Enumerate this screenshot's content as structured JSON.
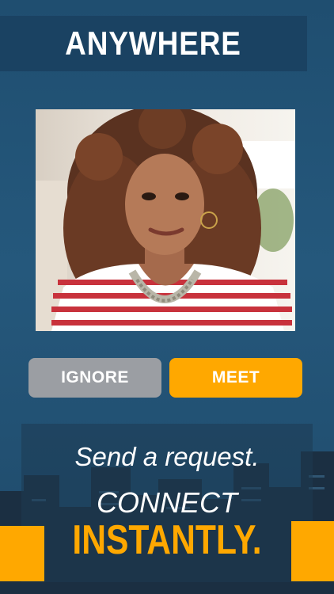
{
  "header": {
    "title": "ANYWHERE"
  },
  "profile": {
    "photo_alt": "Portrait of a smiling woman with curly hair in a striped shirt"
  },
  "actions": {
    "ignore_label": "IGNORE",
    "meet_label": "MEET"
  },
  "promo": {
    "tagline": "Send a request.",
    "headline_line1": "CONNECT",
    "headline_line2": "INSTANTLY."
  },
  "colors": {
    "background": "#25587c",
    "accent": "#ffa800",
    "ignore_button": "#9b9ea3",
    "banner": "#1a4262"
  }
}
